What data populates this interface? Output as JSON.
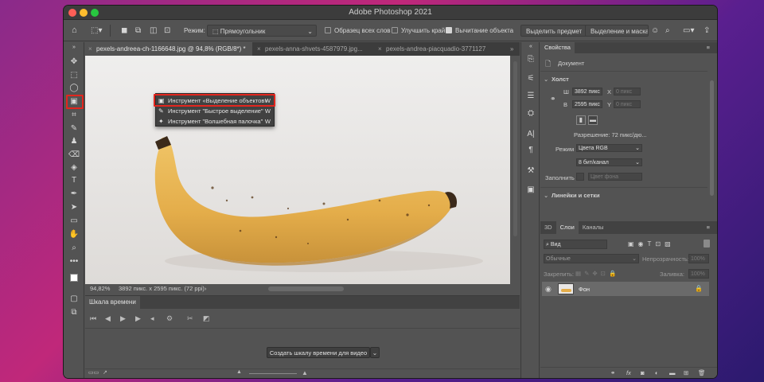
{
  "window": {
    "title": "Adobe Photoshop 2021"
  },
  "options_bar": {
    "mode_label": "Режим:",
    "mode_value": "Прямоугольник",
    "sample_all_layers": "Образец всех слов",
    "improve_edge": "Улучшить край",
    "subtract_object": "Вычитание объекта",
    "select_subject": "Выделить предмет",
    "select_and_mask": "Выделение и маска..."
  },
  "tabs": [
    {
      "label": "pexels-andreea-ch-1166648.jpg @ 94,8% (RGB/8*) *"
    },
    {
      "label": "pexels-anna-shvets-4587979.jpg..."
    },
    {
      "label": "pexels-andrea-piacquadio-3771127"
    }
  ],
  "tab_overflow": "»",
  "flyout": {
    "items": [
      {
        "label": "Инструмент «Выделение объектов»",
        "key": "W"
      },
      {
        "label": "Инструмент \"Быстрое выделение\"",
        "key": "W"
      },
      {
        "label": "Инструмент \"Волшебная палочка\"",
        "key": "W"
      }
    ]
  },
  "status": {
    "zoom": "94,82%",
    "info": "3892 пикс. x 2595 пикс. (72 ppi)",
    "arrow": "›"
  },
  "timeline": {
    "tab": "Шкала времени",
    "create_button": "Создать шкалу времени для видео"
  },
  "properties": {
    "tab": "Свойства",
    "document": "Документ",
    "canvas_title": "Холст",
    "w_label": "Ш",
    "w_value": "3892 пикс",
    "h_label": "В",
    "h_value": "2595 пикс",
    "x_label": "X",
    "x_value": "0 пикс",
    "y_label": "Y",
    "y_value": "0 пикс",
    "resolution": "Разрешение: 72 пикс/дю...",
    "mode_label": "Режим",
    "mode_value": "Цвета RGB",
    "bits_value": "8 бит/канал",
    "fill_label": "Заполнить",
    "fill_value": "Цвет фона",
    "rulers_title": "Линейки и сетки"
  },
  "layers_panel": {
    "tabs": [
      "3D",
      "Слои",
      "Каналы"
    ],
    "search_placeholder": "Вид",
    "blend_mode": "Обычные",
    "opacity_label": "Непрозрачность:",
    "opacity_value": "100%",
    "lock_label": "Закрепить:",
    "fill_label": "Заливка:",
    "fill_value": "100%",
    "layer_name": "Фон"
  }
}
